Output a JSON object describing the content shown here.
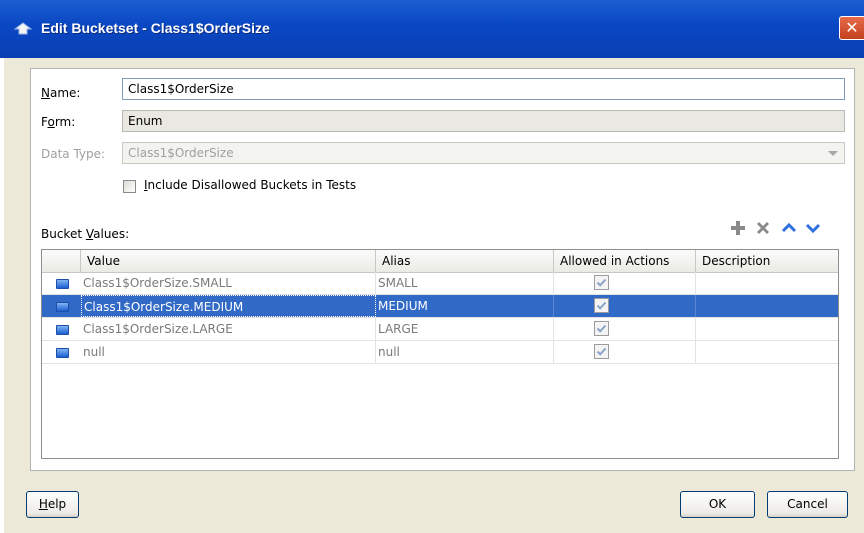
{
  "window": {
    "title": "Edit Bucketset - Class1$OrderSize",
    "close_glyph": "✕"
  },
  "form": {
    "name_label": "Name:",
    "name_label_accel": "N",
    "name_label_rest": "ame:",
    "name_value": "Class1$OrderSize",
    "form_label_pre": "F",
    "form_label_accel": "o",
    "form_label_rest": "rm:",
    "form_value": "Enum",
    "datatype_label": "Data Type:",
    "datatype_value": "Class1$OrderSize",
    "include_label_accel": "I",
    "include_label_rest": "nclude Disallowed Buckets in Tests"
  },
  "bucket_values": {
    "label_pre": "Bucket ",
    "label_accel": "V",
    "label_rest": "alues:",
    "toolbar": [
      "add-icon",
      "delete-icon",
      "move-up-icon",
      "move-down-icon"
    ],
    "columns": [
      "Value",
      "Alias",
      "Allowed in Actions",
      "Description"
    ],
    "rows": [
      {
        "value": "Class1$OrderSize.SMALL",
        "alias": "SMALL",
        "allowed": true,
        "description": "",
        "selected": false
      },
      {
        "value": "Class1$OrderSize.MEDIUM",
        "alias": "MEDIUM",
        "allowed": true,
        "description": "",
        "selected": true
      },
      {
        "value": "Class1$OrderSize.LARGE",
        "alias": "LARGE",
        "allowed": true,
        "description": "",
        "selected": false
      },
      {
        "value": "null",
        "alias": "null",
        "allowed": true,
        "description": "",
        "selected": false
      }
    ]
  },
  "buttons": {
    "help_accel": "H",
    "help_rest": "elp",
    "ok": "OK",
    "cancel": "Cancel"
  },
  "colors": {
    "titlebar": "#0a48c4",
    "selection": "#3169c6",
    "dialog_bg": "#ece9d8"
  }
}
